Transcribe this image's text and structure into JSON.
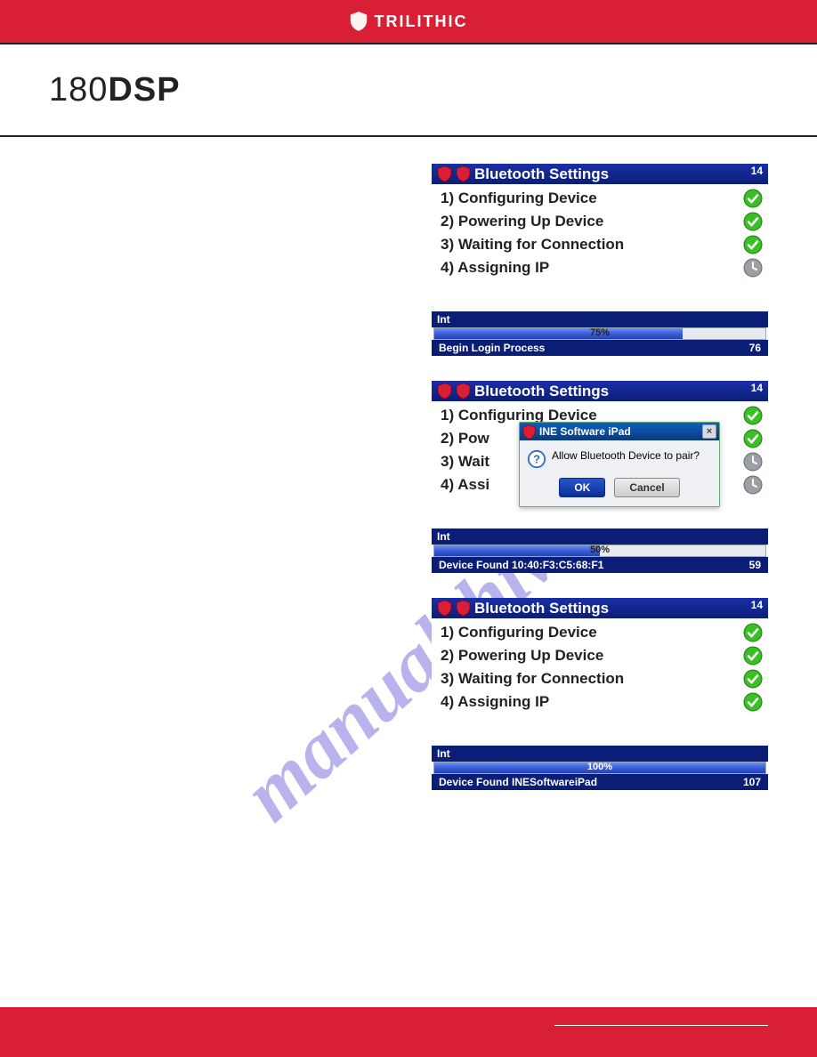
{
  "brand": "TRILITHIC",
  "product": {
    "left": "180",
    "right": "DSP"
  },
  "watermark": "manualshive.com",
  "footer_section": "",
  "footer_pageinfo": "",
  "screens": [
    {
      "title": "Bluetooth Settings",
      "hb": "14",
      "steps": [
        {
          "label": "1) Configuring Device",
          "status": "check"
        },
        {
          "label": "2) Powering Up Device",
          "status": "check"
        },
        {
          "label": "3) Waiting for Connection",
          "status": "check"
        },
        {
          "label": "4) Assigning IP",
          "status": "clock"
        }
      ],
      "info_left": "Int",
      "progress": {
        "pct": 75,
        "label": "75%"
      },
      "foot_left": "Begin Login Process",
      "foot_right": "76"
    },
    {
      "title": "Bluetooth Settings",
      "hb": "14",
      "steps": [
        {
          "label": "1) Configuring Device",
          "status": "check"
        },
        {
          "label": "2) Pow",
          "status": "check"
        },
        {
          "label": "3) Wait",
          "status": "clock"
        },
        {
          "label": "4) Assi",
          "status": "clock"
        }
      ],
      "info_left": "Int",
      "progress": {
        "pct": 50,
        "label": "50%"
      },
      "foot_left": "Device Found 10:40:F3:C5:68:F1",
      "foot_right": "59",
      "dialog": {
        "title": "INE Software iPad",
        "message": "Allow Bluetooth Device to pair?",
        "ok": "OK",
        "cancel": "Cancel"
      }
    },
    {
      "title": "Bluetooth Settings",
      "hb": "14",
      "steps": [
        {
          "label": "1) Configuring Device",
          "status": "check"
        },
        {
          "label": "2) Powering Up Device",
          "status": "check"
        },
        {
          "label": "3) Waiting for Connection",
          "status": "check"
        },
        {
          "label": "4) Assigning IP",
          "status": "check"
        }
      ],
      "info_left": "Int",
      "progress": {
        "pct": 100,
        "label": "100%"
      },
      "foot_left": "Device Found INESoftwareiPad",
      "foot_right": "107"
    }
  ]
}
